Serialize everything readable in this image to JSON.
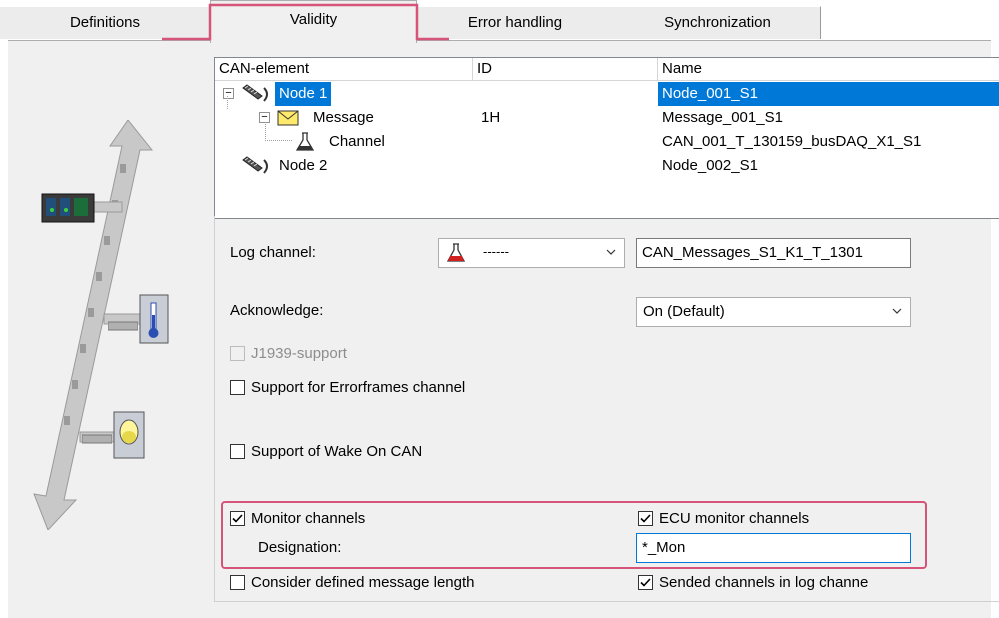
{
  "tabs": [
    "Definitions",
    "Validity",
    "Error handling",
    "Synchronization"
  ],
  "list": {
    "columns": [
      "CAN-element",
      "ID",
      "Name"
    ],
    "rows": [
      {
        "label": "Node 1",
        "id": "",
        "name": "Node_001_S1",
        "icon": "node-icon",
        "expander": "−"
      },
      {
        "label": "Message",
        "id": "1H",
        "name": "Message_001_S1",
        "icon": "envelope-icon",
        "expander": "−"
      },
      {
        "label": "Channel",
        "id": "",
        "name": "CAN_001_T_130159_busDAQ_X1_S1",
        "icon": "flask-icon"
      },
      {
        "label": "Node 2",
        "id": "",
        "name": "Node_002_S1",
        "icon": "node-icon"
      }
    ]
  },
  "log_channel": {
    "label": "Log channel:",
    "combo_value": "------",
    "text_value": "CAN_Messages_S1_K1_T_1301"
  },
  "acknowledge": {
    "label": "Acknowledge:",
    "value": "On (Default)"
  },
  "checks": {
    "j1939": {
      "label": "J1939-support",
      "checked": false,
      "disabled": true
    },
    "errorframes": {
      "label": "Support for Errorframes channel",
      "checked": false
    },
    "wake_on_can": {
      "label": "Support of Wake On CAN",
      "checked": false
    },
    "monitor": {
      "label": "Monitor channels",
      "checked": true
    },
    "ecu_monitor": {
      "label": "ECU monitor channels",
      "checked": true
    },
    "msg_length": {
      "label": "Consider defined message length",
      "checked": false
    },
    "sended": {
      "label": "Sended channels in log channe",
      "checked": true
    }
  },
  "designation": {
    "label": "Designation:",
    "value": "*_Mon"
  },
  "colors": {
    "selection": "#0078d7",
    "highlight": "#d6537a",
    "bus_arrow": "#c8c8c8"
  }
}
